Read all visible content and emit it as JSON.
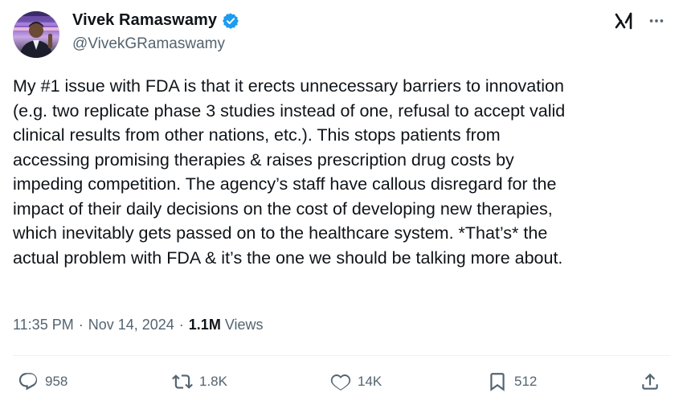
{
  "author": {
    "display_name": "Vivek Ramaswamy",
    "handle": "@VivekGRamaswamy",
    "verified_color": "#1d9bf0"
  },
  "header_icons": [
    "grok-icon",
    "more-icon"
  ],
  "tweet": {
    "lines": [
      "My #1 issue with FDA is that it erects unnecessary barriers to innovation",
      "(e.g. two replicate phase 3 studies instead of one, refusal to accept valid",
      "clinical results from other nations, etc.). This stops patients from",
      "accessing promising therapies & raises prescription drug costs by",
      "impeding competition. The agency’s staff have callous disregard for the",
      "impact of their daily decisions on the cost of developing new therapies,",
      "which inevitably gets passed on to the healthcare system. *That’s* the",
      "actual problem with FDA & it’s the one we should be talking more about."
    ]
  },
  "meta": {
    "time": "11:35 PM",
    "date": "Nov 14, 2024",
    "views_count": "1.1M",
    "views_label": "Views"
  },
  "actions": {
    "replies": "958",
    "reposts": "1.8K",
    "likes": "14K",
    "bookmarks": "512"
  }
}
